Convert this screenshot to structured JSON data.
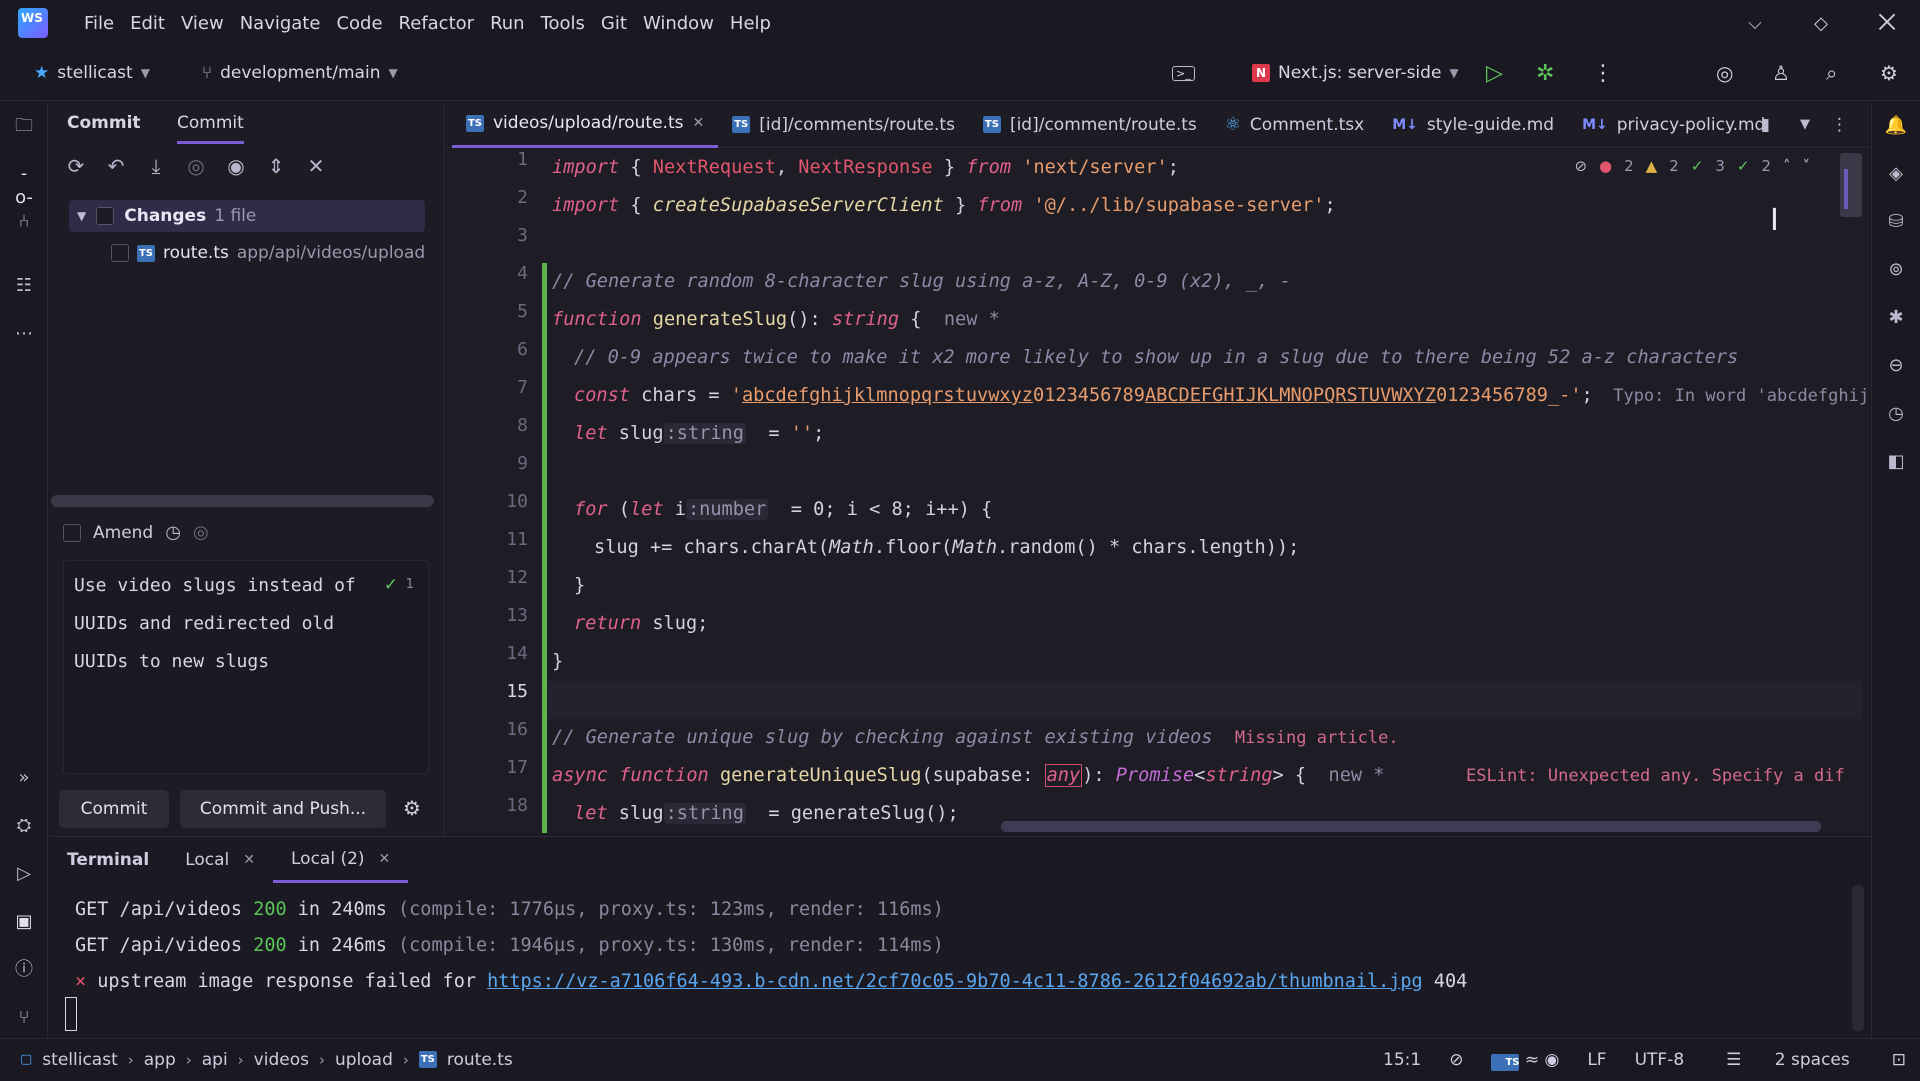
{
  "menu": [
    "File",
    "Edit",
    "View",
    "Navigate",
    "Code",
    "Refactor",
    "Run",
    "Tools",
    "Git",
    "Window",
    "Help"
  ],
  "logo_text": "WS",
  "toolbar": {
    "project": "stellicast",
    "branch": "development/main",
    "run_config": "Next.js: server-side"
  },
  "commit_panel": {
    "tab_commit_label": "Commit",
    "tab_commit2_label": "Commit",
    "changes_label": "Changes",
    "changes_count": "1 file",
    "file_name": "route.ts",
    "file_path": "app/api/videos/upload",
    "amend_label": "Amend",
    "message_lines": [
      "Use video slugs instead of",
      "UUIDs and redirected old",
      "UUIDs to new slugs"
    ],
    "check_count": "1",
    "commit_button": "Commit",
    "commit_push_button": "Commit and Push..."
  },
  "editor_tabs": [
    {
      "label": "videos/upload/route.ts",
      "badge": "TS",
      "active": true
    },
    {
      "label": "[id]/comments/route.ts",
      "badge": "TS",
      "active": false
    },
    {
      "label": "[id]/comment/route.ts",
      "badge": "TS",
      "active": false
    },
    {
      "label": "Comment.tsx",
      "badge": "react",
      "active": false
    },
    {
      "label": "style-guide.md",
      "badge": "M↓",
      "active": false
    },
    {
      "label": "privacy-policy.md",
      "badge": "M↓",
      "active": false
    }
  ],
  "inspections": {
    "errors": "2",
    "warnings": "2",
    "weak1": "3",
    "weak2": "2"
  },
  "editor": {
    "line_numbers": [
      "1",
      "2",
      "3",
      "4",
      "5",
      "6",
      "7",
      "8",
      "9",
      "10",
      "11",
      "12",
      "13",
      "14",
      "15",
      "16",
      "17",
      "18"
    ],
    "current_line": "15",
    "l1_kw": "import",
    "l1_a": " { ",
    "l1_c1": "NextRequest",
    "l1_b": ", ",
    "l1_c2": "NextResponse",
    "l1_d": " } ",
    "l1_from": "from",
    "l1_str": "'next/server'",
    "l1_e": ";",
    "l2_kw": "import",
    "l2_a": " { ",
    "l2_fn": "createSupabaseServerClient",
    "l2_d": " } ",
    "l2_from": "from",
    "l2_str": "'@/../lib/supabase-server'",
    "l2_e": ";",
    "l4": "// Generate random 8-character slug using a-z, A-Z, 0-9 (x2), _, -",
    "l5_kw": "function",
    "l5_fn": "generateSlug",
    "l5_b": "(): ",
    "l5_ty": "string",
    "l5_c": " {  ",
    "l5_new": "new *",
    "l6": "// 0-9 appears twice to make it x2 more likely to show up in a slug due to there being 52 a-z characters",
    "l7_kw": "const",
    "l7_b": " chars = ",
    "l7_str_a": "'",
    "l7_str_u1": "abcdefghijklmnopqrstuvwxyz",
    "l7_str_b": "0123456789",
    "l7_str_u2": "ABCDEFGHIJKLMNOPQRSTUVWXYZ",
    "l7_str_c": "0123456789_-'",
    "l7_e": ";",
    "l7_inlay": "  Typo: In word 'abcdefghij",
    "l8_kw": "let",
    "l8_b": " slug",
    "l8_hint": ":string",
    "l8_c": "  = ",
    "l8_str": "''",
    "l8_e": ";",
    "l10_kw": "for",
    "l10_a": " (",
    "l10_let": "let",
    "l10_b": " i",
    "l10_hint": ":number",
    "l10_c": "  = 0; i < 8; i++) {",
    "l11": "slug += chars.charAt(",
    "l11_m1": "Math",
    "l11_b": ".floor(",
    "l11_m2": "Math",
    "l11_c": ".random() * chars.length));",
    "l12": "}",
    "l13_kw": "return",
    "l13_b": " slug;",
    "l14": "}",
    "l16_cm": "// Generate unique slug by checking against existing videos",
    "l16_inlay": "Missing article.",
    "l17_kw1": "async",
    "l17_kw2": "function",
    "l17_fn": "generateUniqueSlug",
    "l17_b": "(supabase: ",
    "l17_any": "any",
    "l17_c": "): ",
    "l17_ty": "Promise",
    "l17_d": "<",
    "l17_ty2": "string",
    "l17_e": "> {  ",
    "l17_new": "new *",
    "l17_inlay": "ESLint: Unexpected any. Specify a dif",
    "l18_kw": "let",
    "l18_b": " slug",
    "l18_hint": ":string",
    "l18_c": "  = generateSlug();"
  },
  "terminal": {
    "title": "Terminal",
    "tabs": [
      "Local",
      "Local (2)"
    ],
    "lines": [
      {
        "method": "GET /api/videos ",
        "status": "200",
        "time": " in 240ms ",
        "detail": "(compile: 1776µs, proxy.ts: 123ms, render: 116ms)"
      },
      {
        "method": "GET /api/videos ",
        "status": "200",
        "time": " in 246ms ",
        "detail": "(compile: 1946µs, proxy.ts: 130ms, render: 114ms)"
      }
    ],
    "error_mark": "×",
    "error_text": " upstream image response failed for ",
    "error_url": "https://vz-a7106f64-493.b-cdn.net/2cf70c05-9b70-4c11-8786-2612f04692ab/thumbnail.jpg",
    "error_code": " 404"
  },
  "statusbar": {
    "crumbs": [
      "stellicast",
      "app",
      "api",
      "videos",
      "upload",
      "route.ts"
    ],
    "position": "15:1",
    "line_sep": "LF",
    "encoding": "UTF-8",
    "indent": "2 spaces"
  },
  "colors": {
    "accent": "#7b5bd6",
    "changebar": "#5fb34a",
    "keyword": "#e0608e",
    "string": "#e89c6c"
  }
}
